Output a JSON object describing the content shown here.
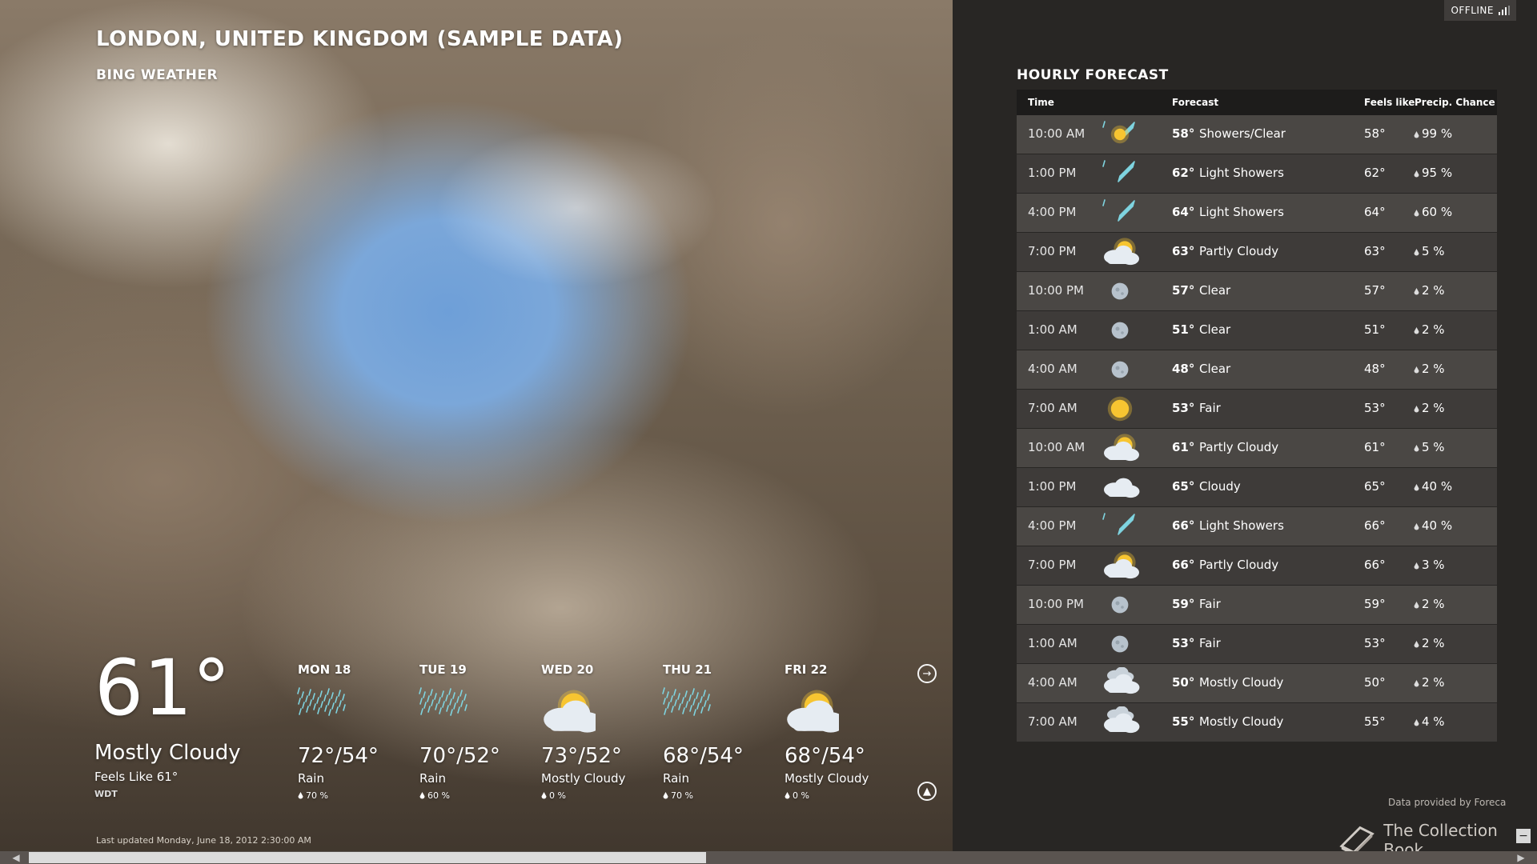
{
  "location": "LONDON, UNITED KINGDOM (SAMPLE DATA)",
  "app_name": "BING WEATHER",
  "status": "OFFLINE",
  "current": {
    "temp": "61°",
    "condition": "Mostly Cloudy",
    "feels_like": "Feels Like 61°",
    "station": "WDT"
  },
  "daily": [
    {
      "day": "MON 18",
      "range": "72°/54°",
      "condition": "Rain",
      "precip": "70 %",
      "icon": "rain-icon"
    },
    {
      "day": "TUE 19",
      "range": "70°/52°",
      "condition": "Rain",
      "precip": "60 %",
      "icon": "rain-icon"
    },
    {
      "day": "WED 20",
      "range": "73°/52°",
      "condition": "Mostly Cloudy",
      "precip": "0 %",
      "icon": "partly-cloudy-icon"
    },
    {
      "day": "THU 21",
      "range": "68°/54°",
      "condition": "Rain",
      "precip": "70 %",
      "icon": "rain-icon"
    },
    {
      "day": "FRI 22",
      "range": "68°/54°",
      "condition": "Mostly Cloudy",
      "precip": "0 %",
      "icon": "partly-cloudy-icon"
    }
  ],
  "last_updated": "Last updated Monday, June 18, 2012 2:30:00 AM",
  "hourly": {
    "title": "HOURLY FORECAST",
    "headers": {
      "time": "Time",
      "forecast": "Forecast",
      "feels_like": "Feels like",
      "precip": "Precip. Chance"
    },
    "rows": [
      {
        "time": "10:00 AM",
        "temp": "58°",
        "condition": "Showers/Clear",
        "feels": "58°",
        "precip": "99 %",
        "icon": "showers-clear-icon"
      },
      {
        "time": "1:00 PM",
        "temp": "62°",
        "condition": "Light Showers",
        "feels": "62°",
        "precip": "95 %",
        "icon": "light-showers-icon"
      },
      {
        "time": "4:00 PM",
        "temp": "64°",
        "condition": "Light Showers",
        "feels": "64°",
        "precip": "60 %",
        "icon": "light-showers-icon"
      },
      {
        "time": "7:00 PM",
        "temp": "63°",
        "condition": "Partly Cloudy",
        "feels": "63°",
        "precip": "5 %",
        "icon": "partly-cloudy-icon"
      },
      {
        "time": "10:00 PM",
        "temp": "57°",
        "condition": "Clear",
        "feels": "57°",
        "precip": "2 %",
        "icon": "moon-icon"
      },
      {
        "time": "1:00 AM",
        "temp": "51°",
        "condition": "Clear",
        "feels": "51°",
        "precip": "2 %",
        "icon": "moon-icon"
      },
      {
        "time": "4:00 AM",
        "temp": "48°",
        "condition": "Clear",
        "feels": "48°",
        "precip": "2 %",
        "icon": "moon-icon"
      },
      {
        "time": "7:00 AM",
        "temp": "53°",
        "condition": "Fair",
        "feels": "53°",
        "precip": "2 %",
        "icon": "sun-icon"
      },
      {
        "time": "10:00 AM",
        "temp": "61°",
        "condition": "Partly Cloudy",
        "feels": "61°",
        "precip": "5 %",
        "icon": "partly-cloudy-icon"
      },
      {
        "time": "1:00 PM",
        "temp": "65°",
        "condition": "Cloudy",
        "feels": "65°",
        "precip": "40 %",
        "icon": "cloudy-icon"
      },
      {
        "time": "4:00 PM",
        "temp": "66°",
        "condition": "Light Showers",
        "feels": "66°",
        "precip": "40 %",
        "icon": "light-showers-icon"
      },
      {
        "time": "7:00 PM",
        "temp": "66°",
        "condition": "Partly Cloudy",
        "feels": "66°",
        "precip": "3 %",
        "icon": "partly-cloudy-icon"
      },
      {
        "time": "10:00 PM",
        "temp": "59°",
        "condition": "Fair",
        "feels": "59°",
        "precip": "2 %",
        "icon": "moon-icon"
      },
      {
        "time": "1:00 AM",
        "temp": "53°",
        "condition": "Fair",
        "feels": "53°",
        "precip": "2 %",
        "icon": "moon-icon"
      },
      {
        "time": "4:00 AM",
        "temp": "50°",
        "condition": "Mostly Cloudy",
        "feels": "50°",
        "precip": "2 %",
        "icon": "mostly-cloudy-icon"
      },
      {
        "time": "7:00 AM",
        "temp": "55°",
        "condition": "Mostly Cloudy",
        "feels": "55°",
        "precip": "4 %",
        "icon": "mostly-cloudy-icon"
      }
    ]
  },
  "provider": "Data provided by Foreca",
  "watermark": "The Collection Book",
  "colors": {
    "rain": "#7fd4e0",
    "sun": "#f7c531",
    "cloud": "#e6ecf2",
    "moon": "#b7c2cc"
  }
}
